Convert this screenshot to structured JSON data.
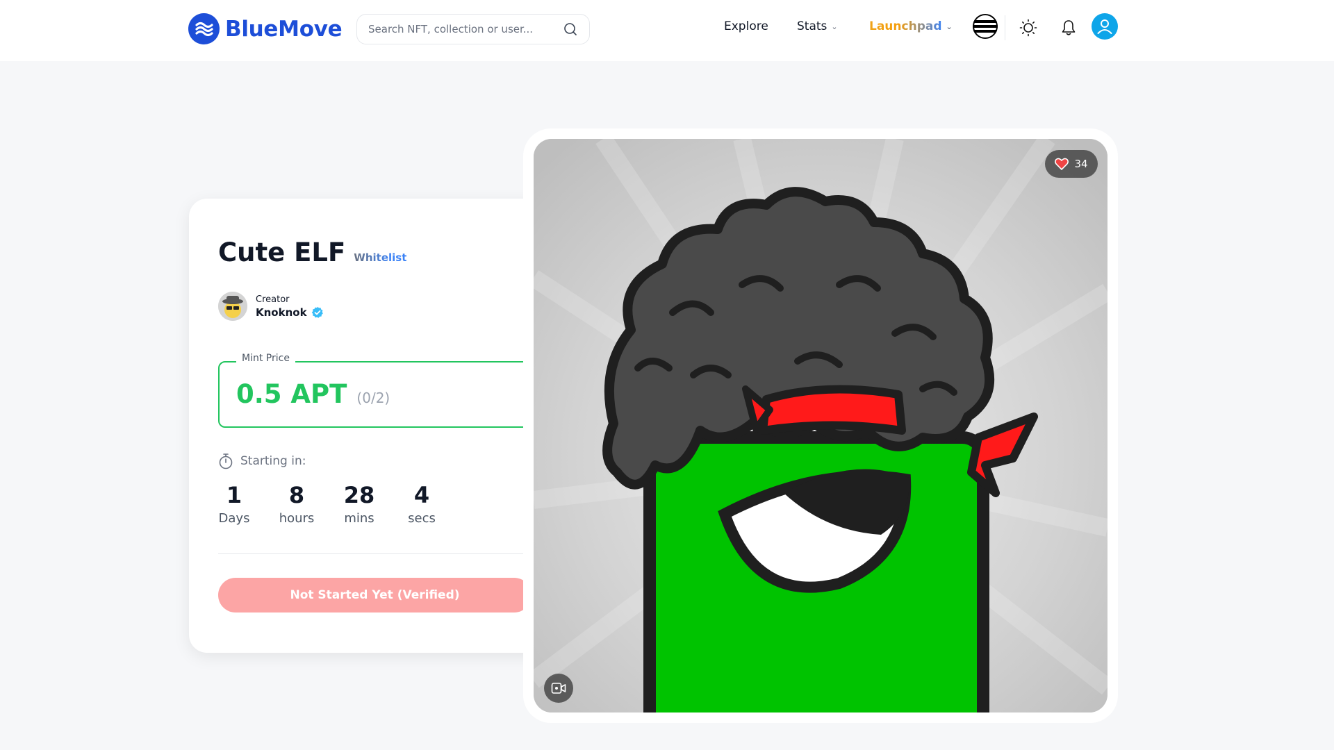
{
  "brand": {
    "name": "BlueMove",
    "color": "#1d4ed8"
  },
  "search": {
    "placeholder": "Search NFT, collection or user..."
  },
  "nav": {
    "explore": "Explore",
    "stats": "Stats",
    "launchpad": "Launchpad"
  },
  "header_icons": [
    "aptos-icon",
    "sun-icon",
    "bell-icon",
    "user-icon"
  ],
  "collection": {
    "title": "Cute ELF",
    "phase": "Whitelist",
    "creator_label": "Creator",
    "creator_name": "Knoknok"
  },
  "mint": {
    "legend": "Mint Price",
    "price": "0.5 APT",
    "count": "(0/2)",
    "accent": "#22c55e"
  },
  "countdown": {
    "label": "Starting in:",
    "units": [
      {
        "value": "1",
        "label": "Days"
      },
      {
        "value": "8",
        "label": "hours"
      },
      {
        "value": "28",
        "label": "mins"
      },
      {
        "value": "4",
        "label": "secs"
      }
    ]
  },
  "action": {
    "label": "Not Started Yet (Verified)",
    "color": "#fca5a5"
  },
  "artwork": {
    "likes": "34"
  }
}
